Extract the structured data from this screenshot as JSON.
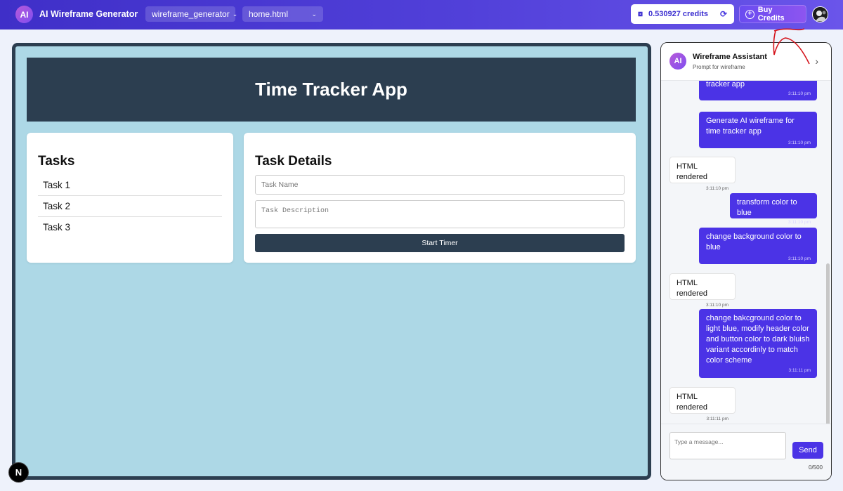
{
  "topbar": {
    "logo_text": "AI",
    "app_title": "AI Wireframe Generator",
    "project_dropdown": "wireframe_generator",
    "file_dropdown": "home.html",
    "credits_text": "0.530927 credits",
    "buy_label": "Buy Credits",
    "brand_color": "#4b33e6"
  },
  "preview": {
    "header_title": "Time Tracker App",
    "tasks": {
      "heading": "Tasks",
      "items": [
        "Task 1",
        "Task 2",
        "Task 3"
      ]
    },
    "details": {
      "heading": "Task Details",
      "name_placeholder": "Task Name",
      "desc_placeholder": "Task Description",
      "button_label": "Start Timer"
    },
    "colors": {
      "background": "#add8e6",
      "header": "#2c3e50",
      "button": "#2c3e50"
    }
  },
  "chat": {
    "avatar_text": "AI",
    "title": "Wireframe Assistant",
    "subtitle": "Prompt for wireframe",
    "messages": [
      {
        "role": "user",
        "text": "tracker app",
        "time": "3:11:10 pm"
      },
      {
        "role": "user",
        "text": "Generate AI wireframe for time tracker app",
        "time": "3:11:10 pm"
      },
      {
        "role": "bot",
        "text": "HTML rendered",
        "time": "3:11:10 pm"
      },
      {
        "role": "user",
        "text": "transform color to blue",
        "time": "3:11:10 pm"
      },
      {
        "role": "user",
        "text": "change background color to blue",
        "time": "3:11:10 pm"
      },
      {
        "role": "bot",
        "text": "HTML rendered",
        "time": "3:11:10 pm"
      },
      {
        "role": "user",
        "text": "change bakcground color to light blue, modify header color and button color to dark bluish variant accordinly to match color scheme",
        "time": "3:11:11 pm"
      },
      {
        "role": "bot",
        "text": "HTML rendered",
        "time": "3:11:11 pm"
      }
    ],
    "input_placeholder": "Type a message...",
    "send_label": "Send",
    "char_counter": "0/500"
  },
  "overlay": {
    "next_badge": "N"
  }
}
